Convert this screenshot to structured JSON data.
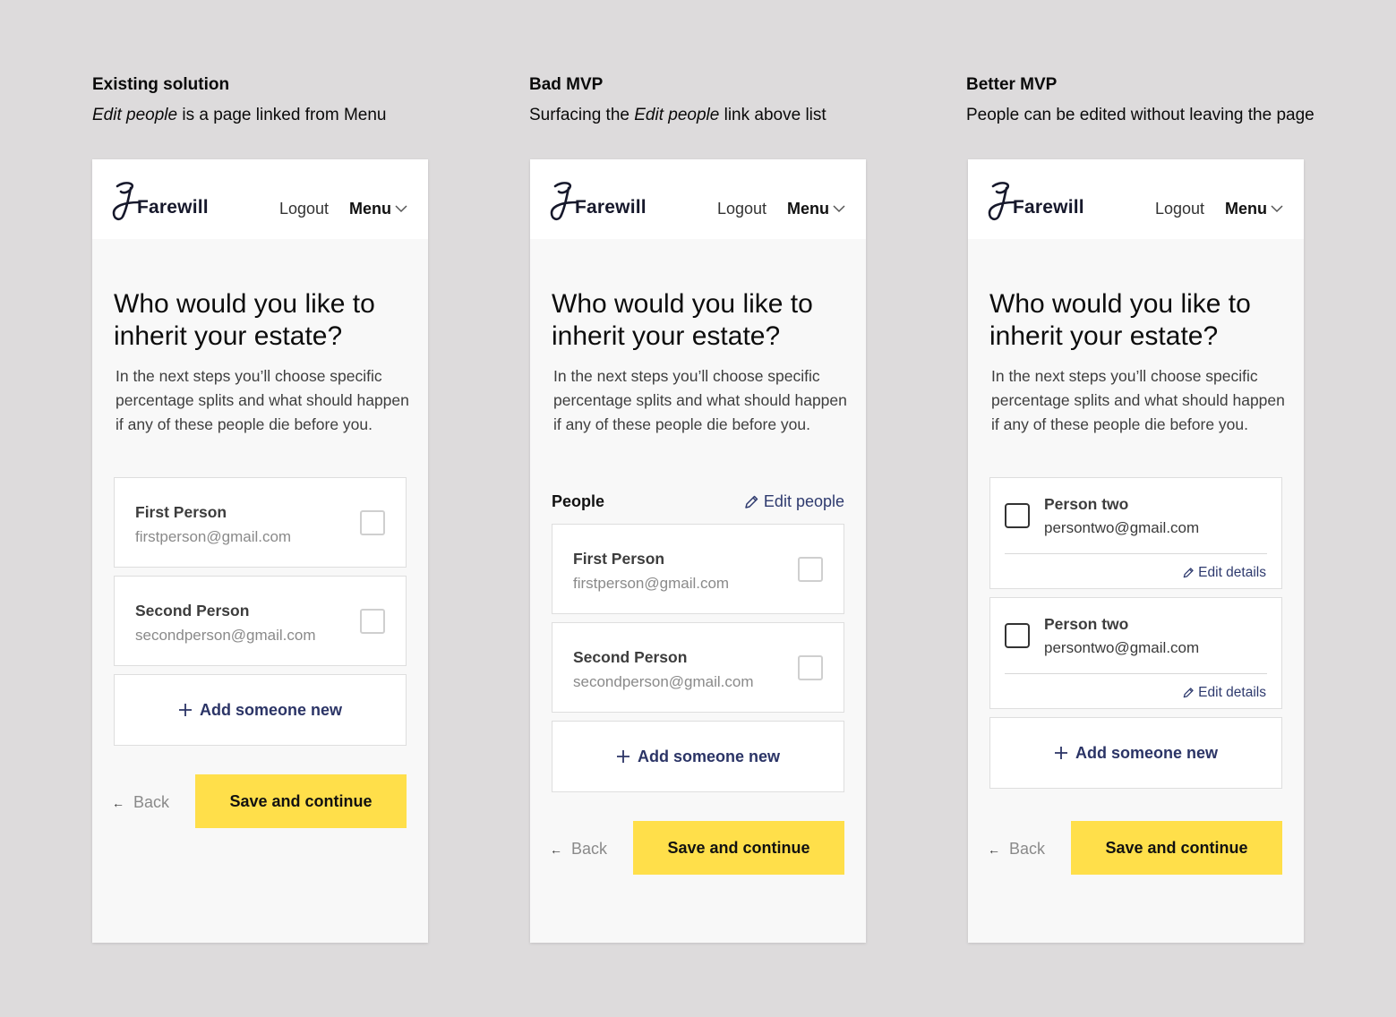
{
  "columns": [
    {
      "title": "Existing solution",
      "desc_pre": "",
      "desc_em": "Edit people",
      "desc_post": " is a page linked from Menu"
    },
    {
      "title": "Bad MVP",
      "desc_pre": "Surfacing the ",
      "desc_em": "Edit people",
      "desc_post": " link above list"
    },
    {
      "title": "Better MVP",
      "desc_pre": "People can be edited without leaving the page",
      "desc_em": "",
      "desc_post": ""
    }
  ],
  "app": {
    "logo_text": "Farewill",
    "logout_label": "Logout",
    "menu_label": "Menu",
    "heading": "Who would you like to inherit your estate?",
    "intro": "In the next steps you’ll choose specific percentage splits and what should happen if any of these people die before you.",
    "add_label": "Add someone new",
    "back_label": "Back",
    "save_label": "Save and continue",
    "people_label": "People",
    "edit_people_label": "Edit people",
    "edit_details_label": "Edit details"
  },
  "people": [
    {
      "name": "First Person",
      "email": "firstperson@gmail.com"
    },
    {
      "name": "Second Person",
      "email": "secondperson@gmail.com"
    }
  ],
  "people_better": [
    {
      "name": "Person two",
      "email": "persontwo@gmail.com"
    },
    {
      "name": "Person two",
      "email": "persontwo@gmail.com"
    }
  ]
}
